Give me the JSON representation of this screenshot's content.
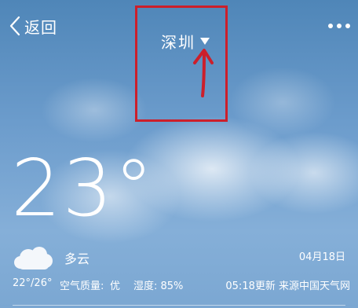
{
  "header": {
    "back_label": "返回",
    "city": "深圳"
  },
  "weather": {
    "current_temp": "23°",
    "condition": "多云",
    "date": "04月18日",
    "temp_range": "22°/26°",
    "air_quality_label": "空气质量:",
    "air_quality_value": "优",
    "humidity": "湿度: 85%",
    "update_source": "05:18更新 来源中国天气网"
  },
  "icons": {
    "back": "chevron-left-icon",
    "more": "more-dots-icon",
    "dropdown": "caret-down-icon",
    "weather": "cloudy-icon"
  },
  "colors": {
    "annotation": "#cc1f2b",
    "text": "#ffffff"
  }
}
